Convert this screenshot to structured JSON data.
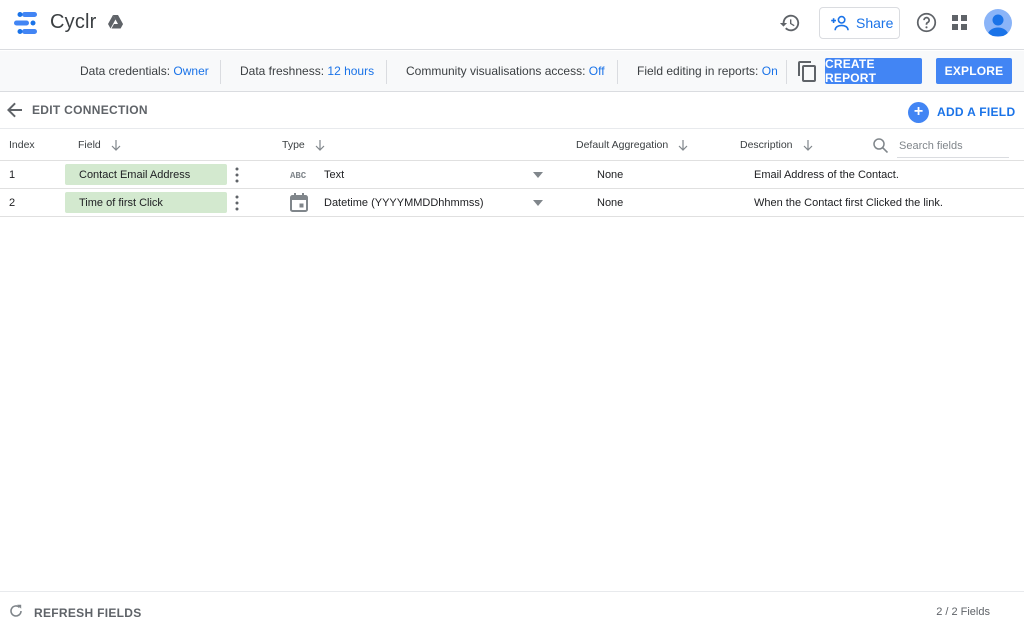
{
  "app": {
    "title": "Cyclr",
    "brand_color": "#1a73e8",
    "icons": [
      "cyclr-logo",
      "google-drive-icon",
      "history-icon",
      "add-person-icon",
      "help-icon",
      "apps-grid-icon",
      "avatar-icon"
    ]
  },
  "header": {
    "share_label": "Share"
  },
  "infobar": {
    "credentials_label": "Data credentials:",
    "credentials_value": "Owner",
    "freshness_label": "Data freshness:",
    "freshness_value": "12 hours",
    "community_label": "Community visualisations access:",
    "community_value": "Off",
    "editing_label": "Field editing in reports:",
    "editing_value": "On",
    "create_report_label": "CREATE REPORT",
    "explore_label": "EXPLORE"
  },
  "connection": {
    "title": "EDIT CONNECTION",
    "add_field_label": "ADD A FIELD"
  },
  "table": {
    "columns": {
      "index": "Index",
      "field": "Field",
      "type": "Type",
      "aggregation": "Default Aggregation",
      "description": "Description"
    },
    "search_placeholder": "Search fields",
    "rows": [
      {
        "index": "1",
        "field": "Contact Email Address",
        "type_icon": "abc-text-icon",
        "type": "Text",
        "aggregation": "None",
        "description": "Email Address of the Contact."
      },
      {
        "index": "2",
        "field": "Time of first Click",
        "type_icon": "calendar-icon",
        "type": "Datetime (YYYYMMDDhhmmss)",
        "aggregation": "None",
        "description": "When the Contact first Clicked the link."
      }
    ]
  },
  "footer": {
    "refresh_label": "REFRESH FIELDS",
    "field_count": "2 / 2 Fields"
  }
}
